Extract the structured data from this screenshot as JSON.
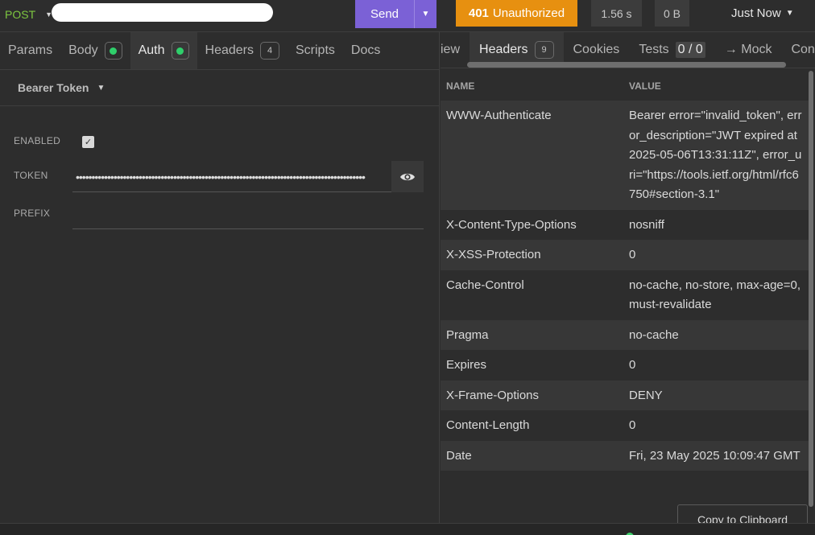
{
  "topbar": {
    "method": "POST",
    "send_label": "Send",
    "status_code": "401",
    "status_text": "Unauthorized",
    "time": "1.56 s",
    "size": "0 B",
    "history_label": "Just Now",
    "colors": {
      "method": "#7dc740",
      "send": "#7b61d6",
      "status": "#e79010"
    }
  },
  "request_tabs": {
    "params": "Params",
    "body": "Body",
    "auth": "Auth",
    "headers": "Headers",
    "headers_count": "4",
    "scripts": "Scripts",
    "docs": "Docs"
  },
  "auth": {
    "type": "Bearer Token",
    "enabled_label": "ENABLED",
    "enabled": true,
    "token_label": "TOKEN",
    "token_masked": "••••••••••••••••••••••••••••••••••••••••••••••••••••••••••••••••••••••••••••••••••••••••••••",
    "prefix_label": "PREFIX",
    "prefix_value": ""
  },
  "response_tabs": {
    "preview_clipped": "iew",
    "headers": "Headers",
    "headers_count": "9",
    "cookies": "Cookies",
    "tests": "Tests",
    "tests_count": "0 / 0",
    "mock": "→ Mock",
    "console_clipped": "Con"
  },
  "response_headers": {
    "name_col": "NAME",
    "value_col": "VALUE",
    "rows": [
      {
        "name": "WWW-Authenticate",
        "value": "Bearer error=\"invalid_token\", error_description=\"JWT expired at 2025-05-06T13:31:11Z\", error_uri=\"https://tools.ietf.org/html/rfc6750#section-3.1\""
      },
      {
        "name": "X-Content-Type-Options",
        "value": "nosniff"
      },
      {
        "name": "X-XSS-Protection",
        "value": "0"
      },
      {
        "name": "Cache-Control",
        "value": "no-cache, no-store, max-age=0, must-revalidate"
      },
      {
        "name": "Pragma",
        "value": "no-cache"
      },
      {
        "name": "Expires",
        "value": "0"
      },
      {
        "name": "X-Frame-Options",
        "value": "DENY"
      },
      {
        "name": "Content-Length",
        "value": "0"
      },
      {
        "name": "Date",
        "value": "Fri, 23 May 2025 10:09:47 GMT"
      }
    ],
    "copy_label": "Copy to Clipboard"
  },
  "icons": {
    "method_caret": "chevron-down-icon",
    "send_dropdown": "chevron-down-icon",
    "history_caret": "chevron-down-icon",
    "auth_type_caret": "chevron-down-icon",
    "token_visibility": "eye-icon",
    "enabled_checkbox": "check-icon"
  }
}
